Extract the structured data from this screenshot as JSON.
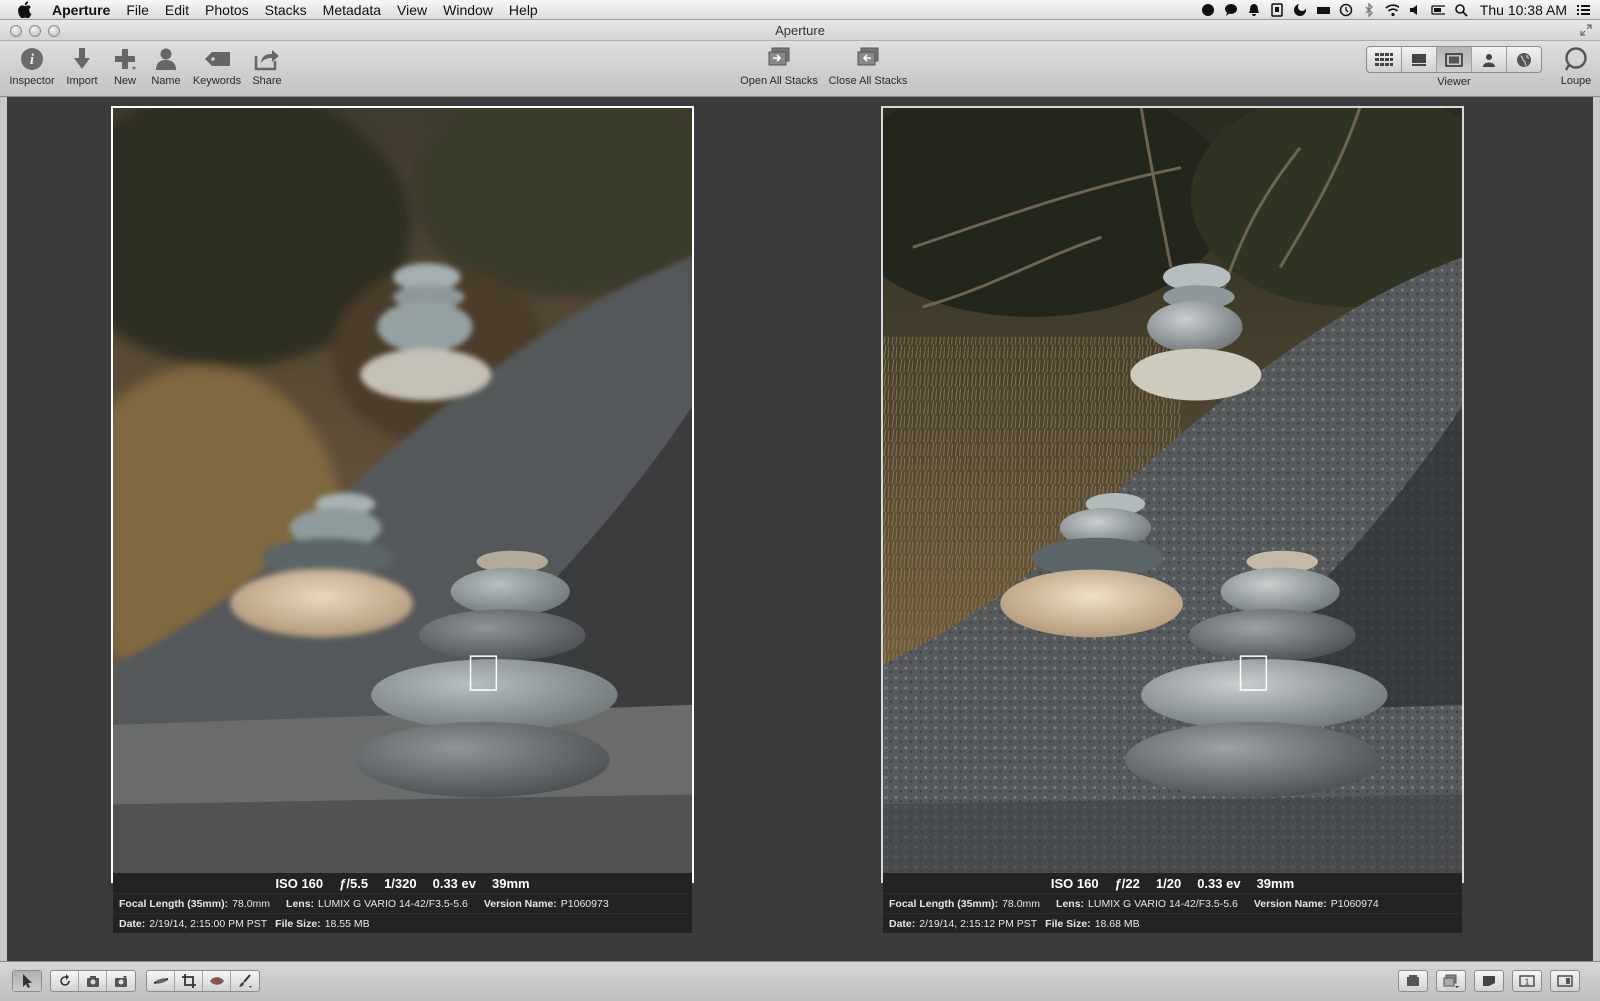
{
  "menubar": {
    "app": "Aperture",
    "items": [
      "File",
      "Edit",
      "Photos",
      "Stacks",
      "Metadata",
      "View",
      "Window",
      "Help"
    ],
    "clock": "Thu 10:38 AM"
  },
  "window": {
    "title": "Aperture"
  },
  "toolbar": {
    "inspector": "Inspector",
    "import": "Import",
    "new": "New",
    "name": "Name",
    "keywords": "Keywords",
    "share": "Share",
    "open_all_stacks": "Open All Stacks",
    "close_all_stacks": "Close All Stacks",
    "viewer": "Viewer",
    "loupe": "Loupe"
  },
  "photos": [
    {
      "iso": "ISO 160",
      "aperture": "ƒ/5.5",
      "shutter": "1/320",
      "ev": "0.33 ev",
      "focal": "39mm",
      "focal_35_label": "Focal Length (35mm):",
      "focal_35": "78.0mm",
      "lens_label": "Lens:",
      "lens": "LUMIX G VARIO 14-42/F3.5-5.6",
      "version_label": "Version Name:",
      "version": "P1060973",
      "date_label": "Date:",
      "date": "2/19/14, 2:15:00 PM PST",
      "size_label": "File Size:",
      "size": "18.55 MB"
    },
    {
      "iso": "ISO 160",
      "aperture": "ƒ/22",
      "shutter": "1/20",
      "ev": "0.33 ev",
      "focal": "39mm",
      "focal_35_label": "Focal Length (35mm):",
      "focal_35": "78.0mm",
      "lens_label": "Lens:",
      "lens": "LUMIX G VARIO 14-42/F3.5-5.6",
      "version_label": "Version Name:",
      "version": "P1060974",
      "date_label": "Date:",
      "date": "2/19/14, 2:15:12 PM PST",
      "size_label": "File Size:",
      "size": "18.68 MB"
    }
  ],
  "icons": {
    "status": [
      "dropbox-icon",
      "chat-icon",
      "notification-icon",
      "clipboard-icon",
      "moon-icon",
      "battery-saver-icon",
      "time-machine-icon",
      "bluetooth-icon",
      "wifi-icon",
      "volume-icon",
      "battery-icon",
      "spotlight-icon",
      "notification-center-icon"
    ]
  },
  "colors": {
    "stage": "#3b3b3b",
    "meta_bg": "#232323"
  }
}
